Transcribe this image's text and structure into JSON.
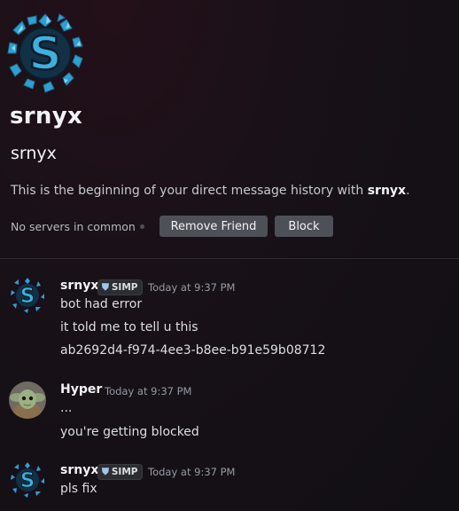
{
  "profile": {
    "display_name": "srnyx",
    "username": "srnyx",
    "intro_prefix": "This is the beginning of your direct message history with ",
    "intro_name": "srnyx",
    "intro_suffix": ".",
    "mutual_servers": "No servers in common",
    "remove_friend_label": "Remove Friend",
    "block_label": "Block"
  },
  "messages": [
    {
      "author": "srnyx",
      "badge": "SIMP",
      "timestamp": "Today at 9:37 PM",
      "lines": [
        "bot had error",
        "it told me to tell u this",
        "ab2692d4-f974-4ee3-b8ee-b91e59b08712"
      ]
    },
    {
      "author": "Hyper",
      "timestamp": "Today at 9:37 PM",
      "lines": [
        "...",
        "you're getting blocked"
      ]
    },
    {
      "author": "srnyx",
      "badge": "SIMP",
      "timestamp": "Today at 9:37 PM",
      "lines": [
        "pls fix"
      ]
    }
  ],
  "colors": {
    "background": "#1a1118",
    "button": "#4e5058",
    "text": "#dbdee1",
    "timestamp": "#949ba4",
    "avatar_blue": "#3fa9d6"
  }
}
